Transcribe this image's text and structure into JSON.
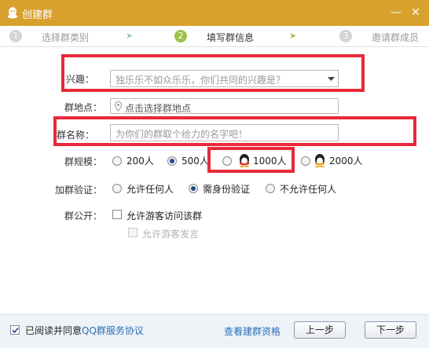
{
  "window": {
    "title": "创建群",
    "minimize_symbol": "—",
    "close_symbol": "✕"
  },
  "steps": [
    {
      "num": "1",
      "label": "选择群类别"
    },
    {
      "num": "2",
      "label": "填写群信息"
    },
    {
      "num": "3",
      "label": "邀请群成员"
    }
  ],
  "step_arrow": "➤",
  "form": {
    "interest_label": "兴趣：",
    "interest_placeholder": "独乐乐不如众乐乐，你们共同的兴趣是？",
    "location_label": "群地点：",
    "location_placeholder": "点击选择群地点",
    "name_label": "群名称：",
    "name_placeholder": "为你们的群取个给力的名字吧！",
    "size_label": "群规模：",
    "size_options": [
      "200人",
      "500人",
      "1000人",
      "2000人"
    ],
    "size_selected": "500人",
    "verify_label": "加群验证：",
    "verify_options": [
      "允许任何人",
      "需身份验证",
      "不允许任何人"
    ],
    "verify_selected": "需身份验证",
    "public_label": "群公开：",
    "public_option": "允许游客访问该群",
    "guest_speak_option": "允许游客发言"
  },
  "footer": {
    "agree_text": "已阅读并同意",
    "agreement_link": "QQ群服务协议",
    "qualification_link": "查看建群资格",
    "prev_button": "上一步",
    "next_button": "下一步"
  },
  "colors": {
    "titlebar": "#d8a12d",
    "highlight_box": "#e8293a",
    "link": "#2a6fb8",
    "step_active": "#9bc34a"
  }
}
